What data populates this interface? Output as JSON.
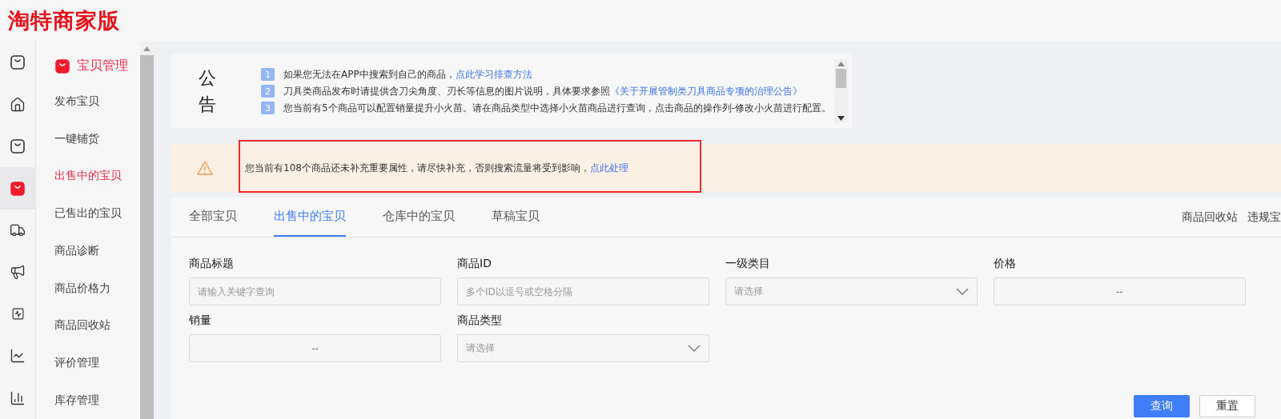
{
  "header": {
    "logo": "淘特商家版"
  },
  "rail": [
    {
      "kind": "bag",
      "selected": false
    },
    {
      "kind": "home",
      "selected": false
    },
    {
      "kind": "bag",
      "selected": false
    },
    {
      "kind": "bag",
      "selected": true
    },
    {
      "kind": "truck",
      "selected": false
    },
    {
      "kind": "megaphone",
      "selected": false
    },
    {
      "kind": "chart",
      "selected": false
    },
    {
      "kind": "trend",
      "selected": false
    },
    {
      "kind": "bars",
      "selected": false
    }
  ],
  "menu": {
    "title": "宝贝管理",
    "items": [
      {
        "label": "发布宝贝",
        "selected": false
      },
      {
        "label": "一键铺货",
        "selected": false
      },
      {
        "label": "出售中的宝贝",
        "selected": true
      },
      {
        "label": "已售出的宝贝",
        "selected": false
      },
      {
        "label": "商品诊断",
        "selected": false
      },
      {
        "label": "商品价格力",
        "selected": false
      },
      {
        "label": "商品回收站",
        "selected": false
      },
      {
        "label": "评价管理",
        "selected": false
      },
      {
        "label": "库存管理",
        "selected": false
      }
    ]
  },
  "notice": {
    "title": "公告",
    "items": [
      {
        "number": "1",
        "text": "如果您无法在APP中搜索到自己的商品，",
        "link": "点此学习排查方法"
      },
      {
        "number": "2",
        "text": "刀具类商品发布时请提供含刀尖角度、刃长等信息的图片说明，具体要求参照",
        "link": "《关于开展管制类刀具商品专项的治理公告》"
      },
      {
        "number": "3",
        "text": "您当前有5个商品可以配置销量提升小火苗。请在商品类型中选择小火苗商品进行查询，点击商品的操作列-修改小火苗进行配置。"
      }
    ]
  },
  "warning": {
    "text": "您当前有108个商品还未补充重要属性，请尽快补充，否则搜索流量将受到影响，",
    "link": "点此处理",
    "highlighted": true
  },
  "tabs": [
    {
      "label": "全部宝贝",
      "selected": false
    },
    {
      "label": "出售中的宝贝",
      "selected": true
    },
    {
      "label": "仓库中的宝贝",
      "selected": false
    },
    {
      "label": "草稿宝贝",
      "selected": false
    }
  ],
  "side_links": [
    "商品回收站",
    "违规宝"
  ],
  "filters": [
    {
      "label": "商品标题",
      "kind": "text",
      "placeholder": "请输入关键字查询"
    },
    {
      "label": "商品ID",
      "kind": "text",
      "placeholder": "多个ID以逗号或空格分隔"
    },
    {
      "label": "一级类目",
      "kind": "select",
      "placeholder": "请选择"
    },
    {
      "label": "价格",
      "kind": "range",
      "value": "--"
    },
    {
      "label": "销量",
      "kind": "range",
      "value": "--"
    },
    {
      "label": "商品类型",
      "kind": "select",
      "placeholder": "请选择"
    }
  ],
  "buttons": [
    {
      "label": "查询",
      "primary": true
    },
    {
      "label": "重置",
      "primary": false
    }
  ]
}
